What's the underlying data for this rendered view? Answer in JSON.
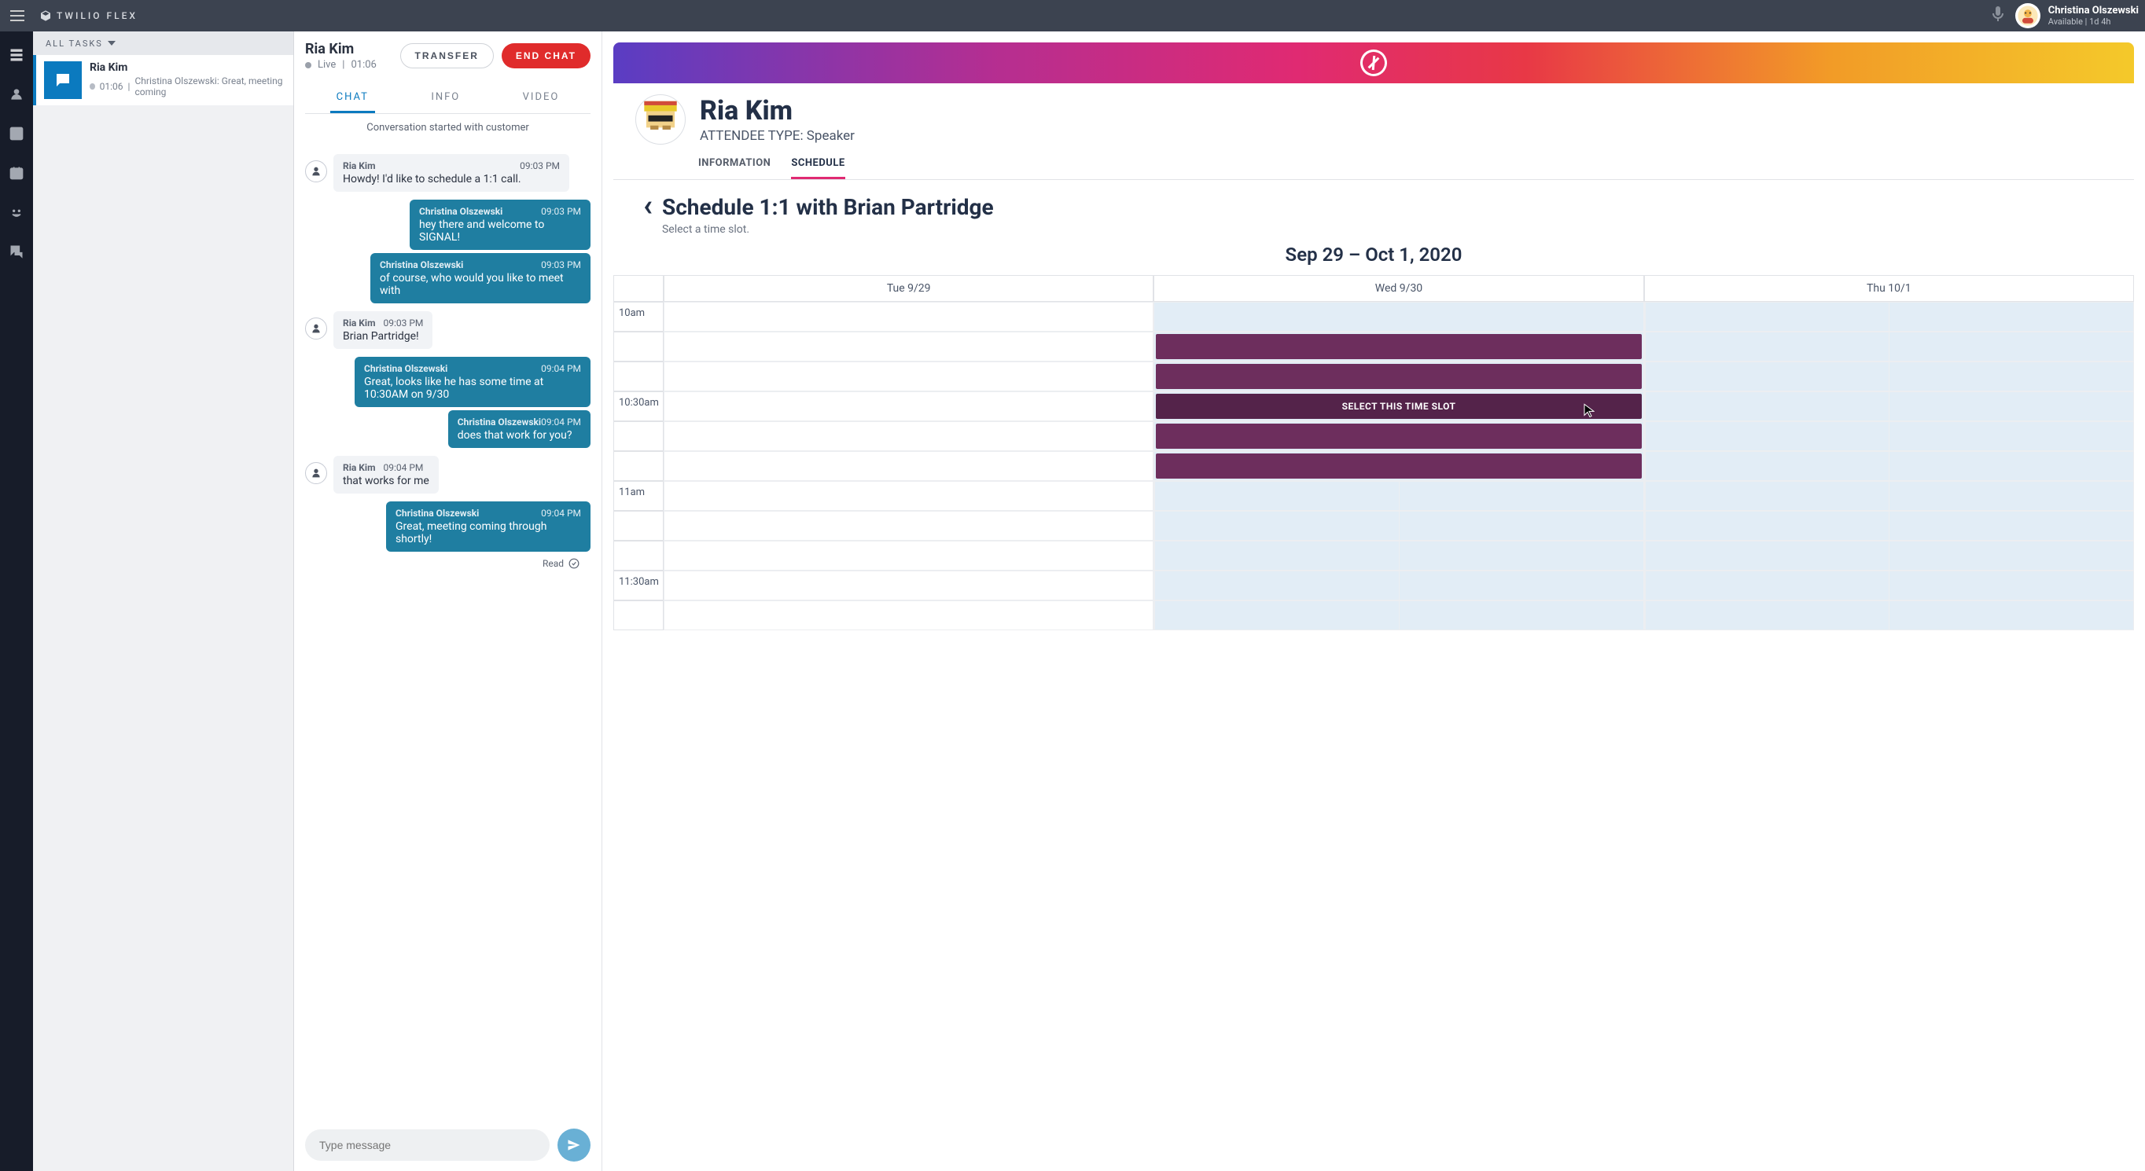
{
  "app": {
    "brand": "TWILIO FLEX"
  },
  "user": {
    "name": "Christina Olszewski",
    "status": "Available | 1d 4h"
  },
  "tasklist": {
    "header": "ALL TASKS",
    "task": {
      "title": "Ria Kim",
      "time": "01:06",
      "preview": "Christina Olszewski: Great, meeting coming"
    }
  },
  "chat": {
    "name": "Ria Kim",
    "status": "Live",
    "duration": "01:06",
    "transfer": "TRANSFER",
    "end": "END CHAT",
    "tabs": {
      "chat": "CHAT",
      "info": "INFO",
      "video": "VIDEO"
    },
    "started": "Conversation started with customer",
    "messages": [
      {
        "dir": "in",
        "name": "Ria Kim",
        "time": "09:03 PM",
        "text": "Howdy! I'd like to schedule a 1:1 call."
      },
      {
        "dir": "out",
        "name": "Christina Olszewski",
        "time": "09:03 PM",
        "text": "hey there and welcome to SIGNAL!"
      },
      {
        "dir": "out",
        "name": "Christina Olszewski",
        "time": "09:03 PM",
        "text": "of course, who would you like to meet with"
      },
      {
        "dir": "in",
        "name": "Ria Kim",
        "time": "09:03 PM",
        "text": "Brian Partridge!"
      },
      {
        "dir": "out",
        "name": "Christina Olszewski",
        "time": "09:04 PM",
        "text": "Great, looks like he has some time at 10:30AM on 9/30"
      },
      {
        "dir": "out",
        "name": "Christina Olszewski",
        "time": "09:04 PM",
        "text": "does that work for you?"
      },
      {
        "dir": "in",
        "name": "Ria Kim",
        "time": "09:04 PM",
        "text": "that works for me"
      },
      {
        "dir": "out",
        "name": "Christina Olszewski",
        "time": "09:04 PM",
        "text": "Great, meeting coming through shortly!"
      }
    ],
    "read": "Read",
    "placeholder": "Type message"
  },
  "profile": {
    "name": "Ria Kim",
    "type_label": "ATTENDEE TYPE: Speaker",
    "tabs": {
      "info": "INFORMATION",
      "schedule": "SCHEDULE"
    }
  },
  "schedule": {
    "title": "Schedule 1:1 with Brian Partridge",
    "subtitle": "Select a time slot.",
    "range": "Sep 29 – Oct 1, 2020",
    "days": [
      "Tue 9/29",
      "Wed 9/30",
      "Thu 10/1"
    ],
    "times": [
      "10am",
      "",
      "",
      "10:30am",
      "",
      "",
      "11am",
      "",
      "",
      "11:30am",
      "",
      ""
    ],
    "select_label": "SELECT THIS TIME SLOT"
  }
}
